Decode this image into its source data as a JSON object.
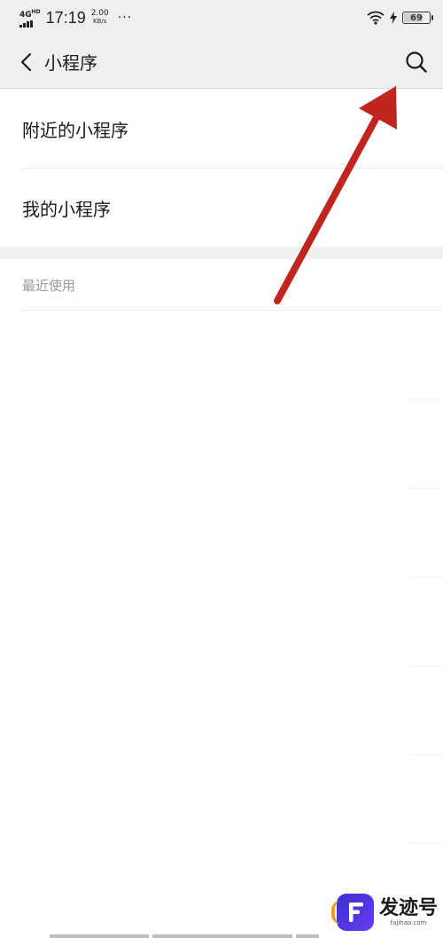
{
  "status_bar": {
    "network": "4G",
    "network_sup": "HD",
    "time": "17:19",
    "speed_value": "2.00",
    "speed_unit": "KB/s",
    "more_dots": "···",
    "battery_level": "69",
    "battery_fraction": 0.69
  },
  "nav": {
    "title": "小程序"
  },
  "menu": {
    "items": [
      {
        "label": "附近的小程序"
      },
      {
        "label": "我的小程序"
      }
    ]
  },
  "recent": {
    "header": "最近使用"
  },
  "watermark": {
    "name": "发迹号",
    "domain": "fajihao.com"
  },
  "colors": {
    "bar_background": "#efefef",
    "arrow": "#c0251f",
    "secondary_text": "#9a9a9a"
  }
}
